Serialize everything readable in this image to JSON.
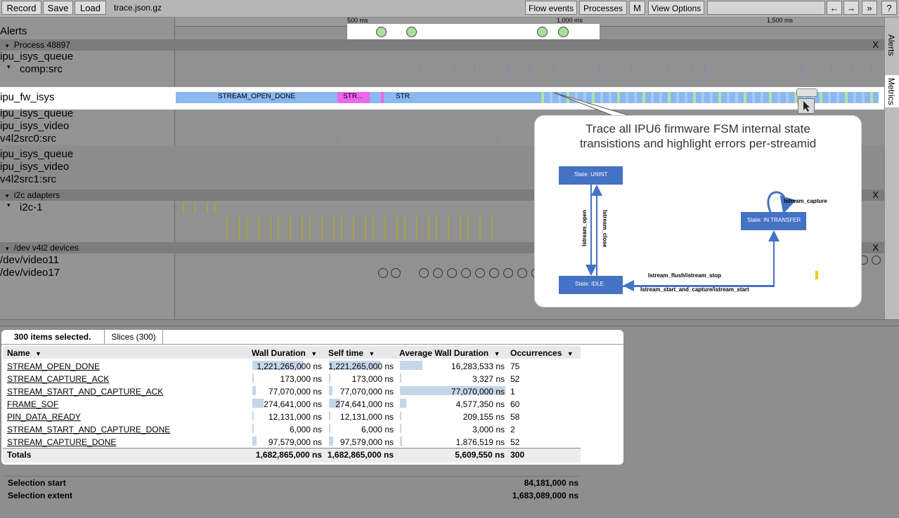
{
  "toolbar": {
    "record": "Record",
    "save": "Save",
    "load": "Load",
    "filename": "trace.json.gz",
    "flow_events": "Flow events",
    "processes": "Processes",
    "m": "M",
    "view_options": "View Options",
    "left_arrow": "←",
    "right_arrow": "→",
    "double_right": "»",
    "help": "?"
  },
  "ruler": {
    "t500": "500 ms",
    "t1000": "1,000 ms",
    "t1500": "1,500 ms"
  },
  "tracks": {
    "alerts": "Alerts",
    "process_header": "Process 48897",
    "ipu_isys_queue_1": "ipu_isys_queue",
    "comp_src": "comp:src",
    "ipu_fw_isys": "ipu_fw_isys",
    "slice_open_done": "STREAM_OPEN_DONE",
    "slice_str1": "STR...",
    "slice_str2": "STR",
    "ipu_isys_queue_2": "ipu_isys_queue",
    "ipu_isys_video_1": "ipu_isys_video",
    "v4l2src0": "v4l2src0:src",
    "ipu_isys_queue_3": "ipu_isys_queue",
    "ipu_isys_video_2": "ipu_isys_video",
    "v4l2src1": "v4l2src1:src",
    "i2c_header": "i2c adapters",
    "i2c_1": "i2c-1",
    "v4l2_header": "/dev v4l2 devices",
    "video11": "/dev/video11",
    "video17": "/dev/video17",
    "close": "X",
    "expand": "▾"
  },
  "sidebar": {
    "alerts": "Alerts",
    "metrics": "Metrics"
  },
  "callout": {
    "title_line1": "Trace all IPU6 firmware FSM internal state",
    "title_line2": "transistions and highlight errors per-streamid",
    "state_unint": "State: UNINT",
    "state_idle": "State: IDLE",
    "state_transfer": "State: IN TRANSFER",
    "edge_open": "Istream_open",
    "edge_close": "Istream_close",
    "edge_capture": "Istream_capture",
    "edge_flush": "Istream_flush/istream_stop",
    "edge_start": "Istream_start_and_capture/istream_start"
  },
  "panel": {
    "selected": "300 items selected.",
    "tab_slices": "Slices (300)",
    "columns": [
      "Name",
      "Wall Duration",
      "Self time",
      "Average Wall Duration",
      "Occurrences"
    ],
    "sort_glyph": "▼",
    "rows": [
      {
        "name": "STREAM_OPEN_DONE",
        "wall": "1,221,265,000 ns",
        "self": "1,221,265,000 ns",
        "avg": "16,283,533 ns",
        "occ": "75",
        "wall_frac": 0.73,
        "avg_frac": 0.21
      },
      {
        "name": "STREAM_CAPTURE_ACK",
        "wall": "173,000 ns",
        "self": "173,000 ns",
        "avg": "3,327 ns",
        "occ": "52",
        "wall_frac": 0.0,
        "avg_frac": 0.0
      },
      {
        "name": "STREAM_START_AND_CAPTURE_ACK",
        "wall": "77,070,000 ns",
        "self": "77,070,000 ns",
        "avg": "77,070,000 ns",
        "occ": "1",
        "wall_frac": 0.05,
        "avg_frac": 1.0
      },
      {
        "name": "FRAME_SOF",
        "wall": "274,641,000 ns",
        "self": "274,641,000 ns",
        "avg": "4,577,350 ns",
        "occ": "60",
        "wall_frac": 0.16,
        "avg_frac": 0.06
      },
      {
        "name": "PIN_DATA_READY",
        "wall": "12,131,000 ns",
        "self": "12,131,000 ns",
        "avg": "209,155 ns",
        "occ": "58",
        "wall_frac": 0.01,
        "avg_frac": 0.0
      },
      {
        "name": "STREAM_START_AND_CAPTURE_DONE",
        "wall": "6,000 ns",
        "self": "6,000 ns",
        "avg": "3,000 ns",
        "occ": "2",
        "wall_frac": 0.0,
        "avg_frac": 0.0
      },
      {
        "name": "STREAM_CAPTURE_DONE",
        "wall": "97,579,000 ns",
        "self": "97,579,000 ns",
        "avg": "1,876,519 ns",
        "occ": "52",
        "wall_frac": 0.06,
        "avg_frac": 0.02
      }
    ],
    "totals": {
      "label": "Totals",
      "wall": "1,682,865,000 ns",
      "self": "1,682,865,000 ns",
      "avg": "5,609,550 ns",
      "occ": "300"
    },
    "selection_start_label": "Selection start",
    "selection_start_value": "84,181,000 ns",
    "selection_extent_label": "Selection extent",
    "selection_extent_value": "1,683,089,000 ns"
  },
  "colors": {
    "slice_blue": "#8ab8ef",
    "slice_pink": "#ee66ee",
    "state_box": "#4472c4",
    "grass": "#a3a350"
  }
}
